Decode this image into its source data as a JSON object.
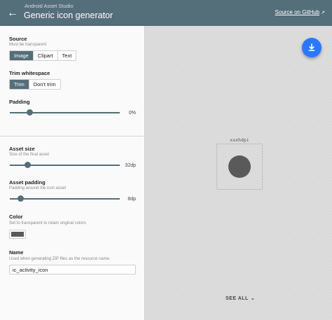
{
  "appbar": {
    "back_icon": "arrow-back-icon",
    "subtitle": "Android Asset Studio",
    "title": "Generic icon generator",
    "source_link": "Source on GitHub",
    "external_icon": "open-in-new-icon",
    "color": "#546e7a"
  },
  "sidebar": {
    "source": {
      "label": "Source",
      "hint": "Must be transparent",
      "options": [
        "Image",
        "Clipart",
        "Text"
      ],
      "selected": "Image"
    },
    "trim": {
      "label": "Trim whitespace",
      "options": [
        "Trim",
        "Don't trim"
      ],
      "selected": "Trim"
    },
    "padding": {
      "label": "Padding",
      "value": "0%",
      "fraction": 0.18
    },
    "asset_size": {
      "label": "Asset size",
      "hint": "Size of the final asset",
      "value": "32dp",
      "fraction": 0.16
    },
    "asset_padding": {
      "label": "Asset padding",
      "hint": "Padding around the icon asset",
      "value": "8dp",
      "fraction": 0.1
    },
    "color": {
      "label": "Color",
      "hint": "Set to transparent to retain original colors",
      "swatch": "#5a5a5a"
    },
    "name": {
      "label": "Name",
      "hint": "Used when generating ZIP files as the resource name.",
      "value": "ic_activity_icon"
    }
  },
  "preview": {
    "download_icon": "download-icon",
    "fab_color": "#2979ff",
    "density": "xxxhdpi",
    "icon_color": "#5a5a5a",
    "see_all": "SEE ALL",
    "chevron_icon": "chevron-down-icon"
  }
}
